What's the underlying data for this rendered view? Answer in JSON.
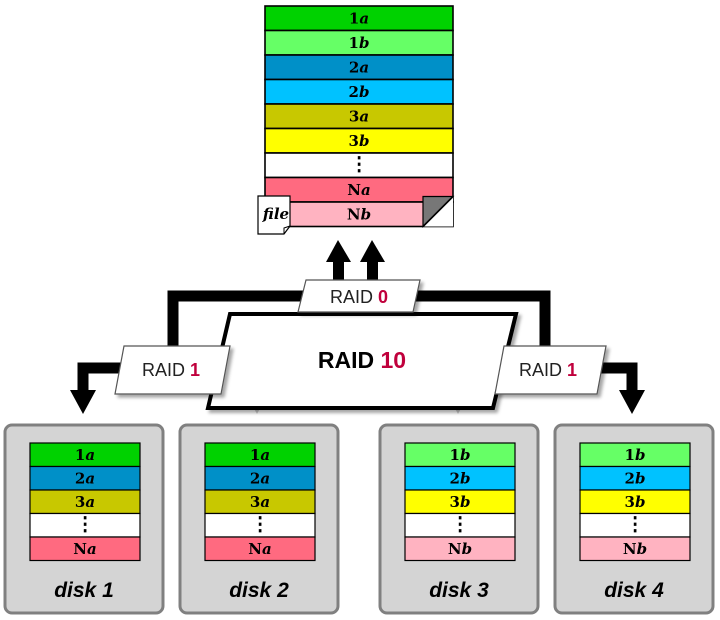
{
  "file": {
    "label": "file",
    "blocks": [
      {
        "num": "1",
        "sub": "a",
        "color": "#00d200"
      },
      {
        "num": "1",
        "sub": "b",
        "color": "#66ff66"
      },
      {
        "num": "2",
        "sub": "a",
        "color": "#0090c8"
      },
      {
        "num": "2",
        "sub": "b",
        "color": "#00c2ff"
      },
      {
        "num": "3",
        "sub": "a",
        "color": "#c8c800"
      },
      {
        "num": "3",
        "sub": "b",
        "color": "#ffff00"
      },
      {
        "num": "",
        "sub": "",
        "color": "#ffffff",
        "dots": true
      },
      {
        "num": "N",
        "sub": "a",
        "color": "#ff6a80"
      },
      {
        "num": "N",
        "sub": "b",
        "color": "#ffb3c1"
      }
    ]
  },
  "raid0": {
    "prefix": "RAID ",
    "num": "0"
  },
  "raid10": {
    "prefix": "RAID ",
    "num": "10"
  },
  "raid1_left": {
    "prefix": "RAID ",
    "num": "1"
  },
  "raid1_right": {
    "prefix": "RAID ",
    "num": "1"
  },
  "colors": {
    "accent_red": "#c0003c",
    "dark_arrow": "#000000",
    "light_arrow": "#cccccc",
    "disk_bg": "#d4d4d4",
    "disk_border": "#808080"
  },
  "disks": [
    {
      "label": "disk 1",
      "blocks": [
        {
          "num": "1",
          "sub": "a",
          "color": "#00d200"
        },
        {
          "num": "2",
          "sub": "a",
          "color": "#0090c8"
        },
        {
          "num": "3",
          "sub": "a",
          "color": "#c8c800"
        },
        {
          "num": "",
          "sub": "",
          "color": "#ffffff",
          "dots": true
        },
        {
          "num": "N",
          "sub": "a",
          "color": "#ff6a80"
        }
      ]
    },
    {
      "label": "disk 2",
      "blocks": [
        {
          "num": "1",
          "sub": "a",
          "color": "#00d200"
        },
        {
          "num": "2",
          "sub": "a",
          "color": "#0090c8"
        },
        {
          "num": "3",
          "sub": "a",
          "color": "#c8c800"
        },
        {
          "num": "",
          "sub": "",
          "color": "#ffffff",
          "dots": true
        },
        {
          "num": "N",
          "sub": "a",
          "color": "#ff6a80"
        }
      ]
    },
    {
      "label": "disk 3",
      "blocks": [
        {
          "num": "1",
          "sub": "b",
          "color": "#66ff66"
        },
        {
          "num": "2",
          "sub": "b",
          "color": "#00c2ff"
        },
        {
          "num": "3",
          "sub": "b",
          "color": "#ffff00"
        },
        {
          "num": "",
          "sub": "",
          "color": "#ffffff",
          "dots": true
        },
        {
          "num": "N",
          "sub": "b",
          "color": "#ffb3c1"
        }
      ]
    },
    {
      "label": "disk 4",
      "blocks": [
        {
          "num": "1",
          "sub": "b",
          "color": "#66ff66"
        },
        {
          "num": "2",
          "sub": "b",
          "color": "#00c2ff"
        },
        {
          "num": "3",
          "sub": "b",
          "color": "#ffff00"
        },
        {
          "num": "",
          "sub": "",
          "color": "#ffffff",
          "dots": true
        },
        {
          "num": "N",
          "sub": "b",
          "color": "#ffb3c1"
        }
      ]
    }
  ]
}
